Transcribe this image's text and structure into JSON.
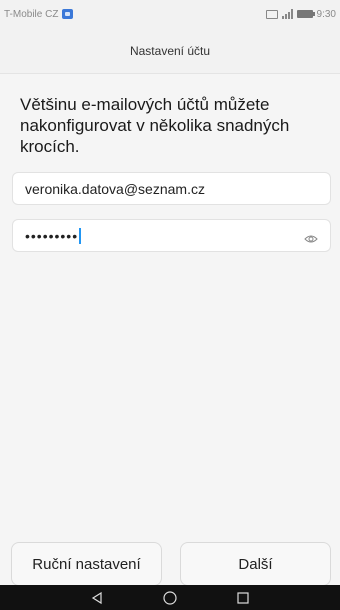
{
  "status_bar": {
    "carrier": "T-Mobile CZ",
    "time": "9:30"
  },
  "header": {
    "title": "Nastavení účtu"
  },
  "intro_text": "Většinu e-mailových účtů můžete nakonfigurovat v několika snadných krocích.",
  "form": {
    "email_value": "veronika.datova@seznam.cz",
    "password_mask": "•••••••••",
    "show_password_icon": "eye-icon"
  },
  "buttons": {
    "manual_label": "Ruční nastavení",
    "next_label": "Další"
  },
  "navigation": {
    "back_icon": "triangle-back-icon",
    "home_icon": "circle-home-icon",
    "recent_icon": "square-recent-icon"
  },
  "colors": {
    "caret": "#2196f3",
    "nav_bar": "#111111",
    "carrier_icon": "#3b78d8"
  }
}
